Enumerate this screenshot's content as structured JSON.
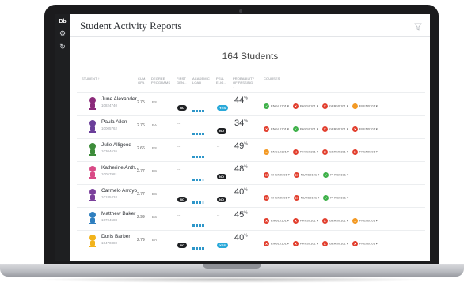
{
  "app": {
    "logo": "Bb",
    "title": "Student Activity Reports"
  },
  "summary": {
    "count_text": "164 Students"
  },
  "columns": {
    "student": "STUDENT ↑",
    "gpa": [
      "CUM.",
      "GPA"
    ],
    "degree": [
      "DEGREE",
      "PROGRAMS"
    ],
    "first_gen": [
      "FIRST",
      "GEN..."
    ],
    "academic_load": [
      "ACADEMIC",
      "LOAD"
    ],
    "pell": [
      "PELL",
      "ELIG..."
    ],
    "probability": [
      "PROBABILITY",
      "OF PASSING",
      "↓"
    ],
    "courses": "COURSES"
  },
  "students": [
    {
      "name": "June Alexander",
      "id": "10824740",
      "gpa": "2.75",
      "degree": "BS",
      "first_gen": "NO",
      "load": 4,
      "pell": "YES",
      "probability": "44",
      "courses": [
        [
          "ENGL0101",
          "g"
        ],
        [
          "PHYS0101",
          "r"
        ],
        [
          "GERM0101",
          "r"
        ],
        [
          "FREN0101",
          "o"
        ]
      ]
    },
    {
      "name": "Paula Allen",
      "id": "10005762",
      "gpa": "2.76",
      "degree": "BA",
      "first_gen": "--",
      "load": 4,
      "pell": "NO",
      "probability": "34",
      "courses": [
        [
          "ENGL0101",
          "r"
        ],
        [
          "PHYS0101",
          "g"
        ],
        [
          "GERM0101",
          "r"
        ],
        [
          "FREN0101",
          "r"
        ]
      ]
    },
    {
      "name": "Julie Alligood",
      "id": "10304626",
      "gpa": "2.66",
      "degree": "BS",
      "first_gen": "--",
      "load": 4,
      "pell": "--",
      "probability": "49",
      "courses": [
        [
          "ENGL0101",
          "o"
        ],
        [
          "PHYS0101",
          "r"
        ],
        [
          "GERM0101",
          "r"
        ],
        [
          "FREN0101",
          "r"
        ]
      ]
    },
    {
      "name": "Katherine Anth...",
      "id": "10057981",
      "gpa": "2.77",
      "degree": "BS",
      "first_gen": "--",
      "load": 3,
      "pell": "NO",
      "probability": "48",
      "courses": [
        [
          "CHEM0101",
          "r"
        ],
        [
          "NURS0101",
          "r"
        ],
        [
          "PHYS0101",
          "g"
        ]
      ]
    },
    {
      "name": "Carmelo Arroyo",
      "id": "10185434",
      "gpa": "2.77",
      "degree": "BS",
      "first_gen": "NO",
      "load": 3,
      "pell": "NO",
      "probability": "40",
      "courses": [
        [
          "CHEM0101",
          "r"
        ],
        [
          "NURS0101",
          "r"
        ],
        [
          "PHYS0101",
          "g"
        ]
      ]
    },
    {
      "name": "Matthew Baker",
      "id": "10704588",
      "gpa": "2.99",
      "degree": "BS",
      "first_gen": "--",
      "load": 4,
      "pell": "--",
      "probability": "45",
      "courses": [
        [
          "ENGL0101",
          "r"
        ],
        [
          "PHYS0101",
          "r"
        ],
        [
          "GERM0101",
          "r"
        ],
        [
          "FREN0101",
          "o"
        ]
      ]
    },
    {
      "name": "Doris Barber",
      "id": "10470380",
      "gpa": "2.79",
      "degree": "BA",
      "first_gen": "NO",
      "load": 4,
      "pell": "YES",
      "probability": "40",
      "courses": [
        [
          "ENGL0101",
          "r"
        ],
        [
          "PHYS0101",
          "r"
        ],
        [
          "GERM0101",
          "r"
        ],
        [
          "FREN0101",
          "r"
        ]
      ]
    }
  ],
  "avatar_colors": [
    "#8b2a7a",
    "#6b3e9a",
    "#3d8c3a",
    "#d94a86",
    "#7a3f9b",
    "#2f7fbf",
    "#f2b31b"
  ],
  "status_colors": {
    "g": "#3fb14a",
    "r": "#e2402f",
    "o": "#f39a25"
  },
  "icons": {
    "rail": [
      "settings-icon",
      "refresh-icon"
    ],
    "filter": "filter-icon"
  }
}
